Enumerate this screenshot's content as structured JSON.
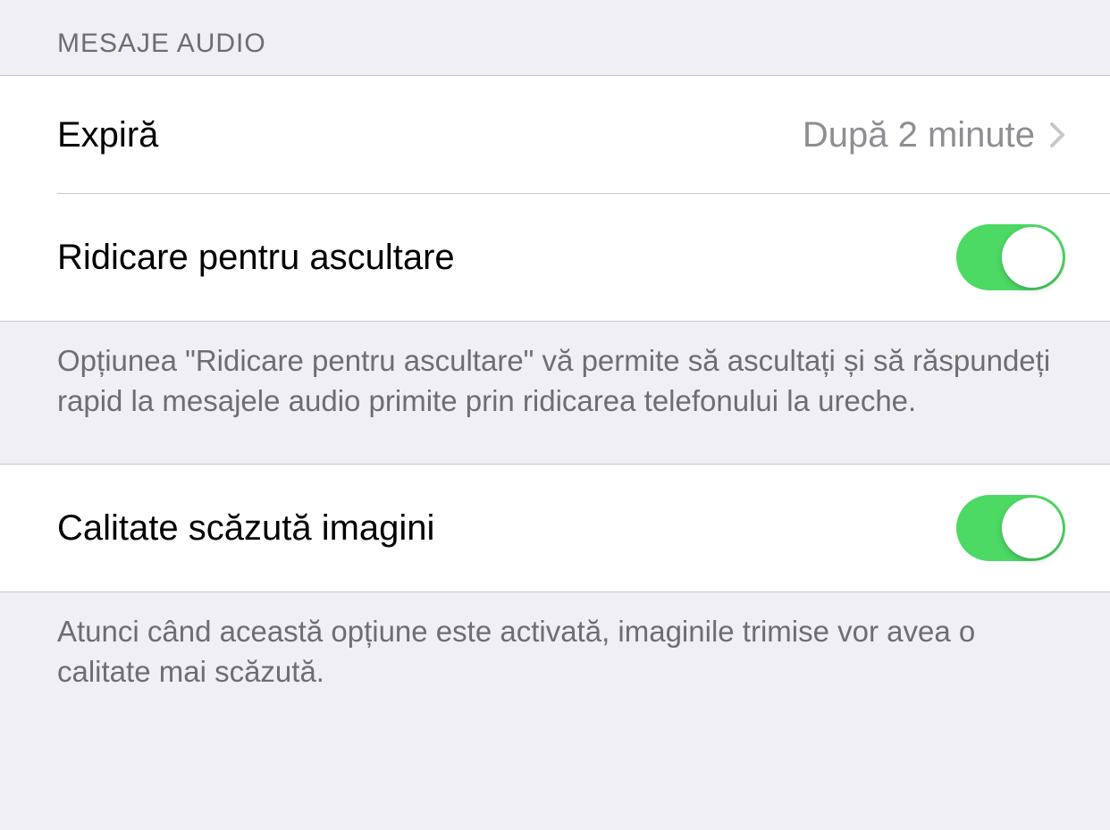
{
  "section1": {
    "header": "Mesaje audio",
    "expire": {
      "label": "Expiră",
      "value": "După 2 minute"
    },
    "raiseToListen": {
      "label": "Ridicare pentru ascultare",
      "enabled": true
    },
    "footer": "Opțiunea \"Ridicare pentru ascultare\" vă permite să ascultați și să răspundeți rapid la mesajele audio primite prin ridicarea telefonului la ureche."
  },
  "section2": {
    "lowQualityImages": {
      "label": "Calitate scăzută imagini",
      "enabled": true
    },
    "footer": "Atunci când această opțiune este activată, imaginile trimise vor avea o calitate mai scăzută."
  }
}
